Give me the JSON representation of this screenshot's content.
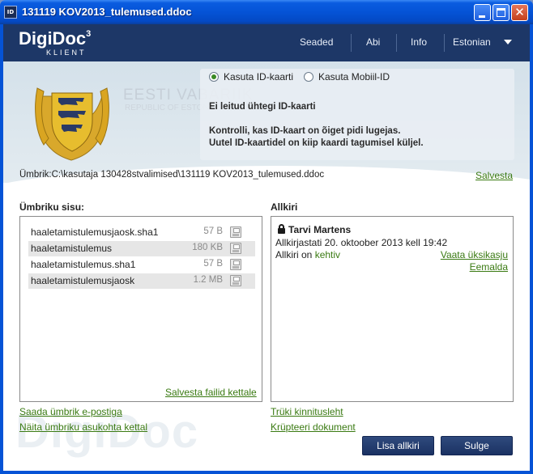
{
  "window": {
    "title": "131119 KOV2013_tulemused.ddoc",
    "icon_text": "ID"
  },
  "header": {
    "brand": "DigiDoc",
    "brand_sup": "3",
    "brand_sub": "KLIENT",
    "nav": [
      "Seaded",
      "Abi",
      "Info"
    ],
    "language": "Estonian"
  },
  "coat_of_arms": {
    "text": "EESTI VABARIIK",
    "sub": "REPUBLIC OF ESTONIA"
  },
  "id_panel": {
    "option_id_card": "Kasuta ID-kaarti",
    "option_mobile_id": "Kasuta Mobiil-ID",
    "selected": "id_card",
    "msg_none": "Ei leitud ühtegi ID-kaarti",
    "msg_check_1": "Kontrolli, kas ID-kaart on õiget pidi lugejas.",
    "msg_check_2": "Uutel ID-kaartidel on kiip kaardi tagumisel küljel."
  },
  "envelope": {
    "path": "Ümbrik:C:\\kasutaja 130428stvalimised\\131119 KOV2013_tulemused.ddoc",
    "save_label": "Salvesta"
  },
  "contents": {
    "title": "Ümbriku sisu:",
    "files": [
      {
        "name": "haaletamistulemusjaosk.sha1",
        "size": "57 B"
      },
      {
        "name": "haaletamistulemus",
        "size": "180 KB"
      },
      {
        "name": "haaletamistulemus.sha1",
        "size": "57 B"
      },
      {
        "name": "haaletamistulemusjaosk",
        "size": "1.2 MB"
      }
    ],
    "save_files_label": "Salvesta failid kettale"
  },
  "signatures": {
    "title": "Allkiri",
    "signer": "Tarvi Martens",
    "signed_at": "Allkirjastati 20. oktoober 2013 kell 19:42",
    "status_prefix": "Allkiri on",
    "status_value": "kehtiv",
    "details_label": "Vaata üksikasju",
    "remove_label": "Eemalda"
  },
  "footer_links": {
    "send_email": "Saada ümbrik e-postiga",
    "show_location": "Näita ümbriku asukohta kettal",
    "print_confirmation": "Trüki kinnitusleht",
    "encrypt": "Krüpteeri dokument"
  },
  "buttons": {
    "add_signature": "Lisa allkiri",
    "close": "Sulge"
  },
  "watermark": "DigiDoc",
  "colors": {
    "header_bg": "#1d3767",
    "link_green": "#3a7a12",
    "titlebar_blue": "#0553d6"
  }
}
